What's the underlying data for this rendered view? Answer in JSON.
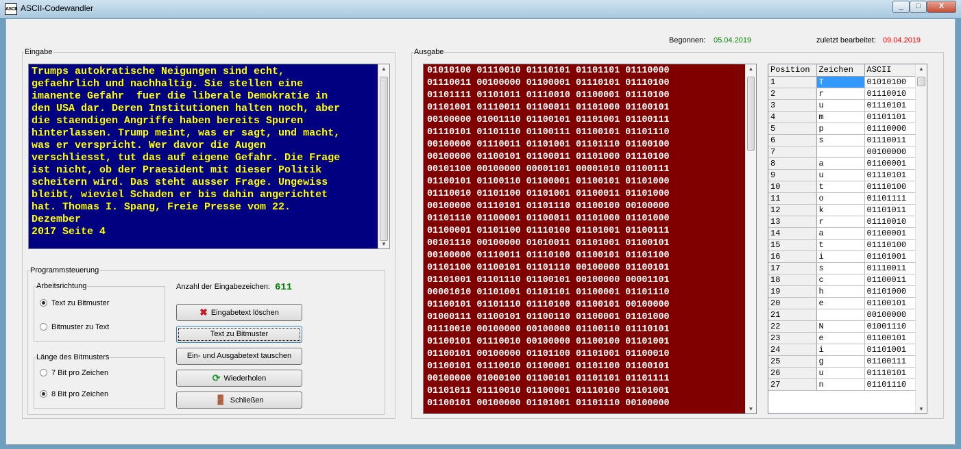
{
  "window": {
    "title": "ASCII-Codewandler",
    "icon_text": "ASCII",
    "minimize": "_",
    "maximize": "□",
    "close": "X"
  },
  "dates": {
    "started_label": "Begonnen:",
    "started_value": "05.04.2019",
    "edited_label": "zuletzt bearbeitet:",
    "edited_value": "09.04.2019"
  },
  "input": {
    "legend": "Eingabe",
    "text": "Trumps autokratische Neigungen sind echt,\ngefaehrlich und nachhaltig. Sie stellen eine\nimanente Gefahr  fuer die liberale Demokratie in\nden USA dar. Deren Institutionen halten noch, aber\ndie staendigen Angriffe haben bereits Spuren\nhinterlassen. Trump meint, was er sagt, und macht,\nwas er verspricht. Wer davor die Augen\nverschliesst, tut das auf eigene Gefahr. Die Frage\nist nicht, ob der Praesident mit dieser Politik\nscheitern wird. Das steht ausser Frage. Ungewiss\nbleibt, wieviel Schaden er bis dahin angerichtet\nhat. Thomas I. Spang, Freie Presse vom 22.\nDezember\n2017 Seite 4"
  },
  "control": {
    "legend": "Programmsteuerung",
    "direction": {
      "legend": "Arbeitsrichtung",
      "options": [
        "Text zu Bitmuster",
        "Bitmuster zu Text"
      ],
      "selected": 0
    },
    "length": {
      "legend": "Länge des Bitmusters",
      "options": [
        "7 Bit pro Zeichen",
        "8 Bit pro Zeichen"
      ],
      "selected": 1
    },
    "count_label": "Anzahl der Eingabezeichen:",
    "count_value": "611",
    "buttons": {
      "clear": "Eingabetext löschen",
      "convert": "Text zu Bitmuster",
      "swap": "Ein- und Ausgabetext tauschen",
      "repeat": "Wiederholen",
      "close": "Schließen"
    }
  },
  "output": {
    "legend": "Ausgabe",
    "text": "01010100 01110010 01110101 01101101 01110000\n01110011 00100000 01100001 01110101 01110100\n01101111 01101011 01110010 01100001 01110100\n01101001 01110011 01100011 01101000 01100101\n00100000 01001110 01100101 01101001 01100111\n01110101 01101110 01100111 01100101 01101110\n00100000 01110011 01101001 01101110 01100100\n00100000 01100101 01100011 01101000 01110100\n00101100 00100000 00001101 00001010 01100111\n01100101 01100110 01100001 01100101 01101000\n01110010 01101100 01101001 01100011 01101000\n00100000 01110101 01101110 01100100 00100000\n01101110 01100001 01100011 01101000 01101000\n01100001 01101100 01110100 01101001 01100111\n00101110 00100000 01010011 01101001 01100101\n00100000 01110011 01110100 01100101 01101100\n01101100 01100101 01101110 00100000 01100101\n01101001 01101110 01100101 00100000 00001101\n00001010 01101001 01101101 01100001 01101110\n01100101 01101110 01110100 01100101 00100000\n01000111 01100101 01100110 01100001 01101000\n01110010 00100000 00100000 01100110 01110101\n01100101 01110010 00100000 01100100 01101001\n01100101 00100000 01101100 01101001 01100010\n01100101 01110010 01100001 01101100 01100101\n00100000 01000100 01100101 01101101 01101111\n01101011 01110010 01100001 01110100 01101001\n01100101 00100000 01101001 01101110 00100000"
  },
  "table": {
    "headers": [
      "Position",
      "Zeichen",
      "ASCII"
    ],
    "rows": [
      [
        "1",
        "T",
        "01010100"
      ],
      [
        "2",
        "r",
        "01110010"
      ],
      [
        "3",
        "u",
        "01110101"
      ],
      [
        "4",
        "m",
        "01101101"
      ],
      [
        "5",
        "p",
        "01110000"
      ],
      [
        "6",
        "s",
        "01110011"
      ],
      [
        "7",
        "",
        "00100000"
      ],
      [
        "8",
        "a",
        "01100001"
      ],
      [
        "9",
        "u",
        "01110101"
      ],
      [
        "10",
        "t",
        "01110100"
      ],
      [
        "11",
        "o",
        "01101111"
      ],
      [
        "12",
        "k",
        "01101011"
      ],
      [
        "13",
        "r",
        "01110010"
      ],
      [
        "14",
        "a",
        "01100001"
      ],
      [
        "15",
        "t",
        "01110100"
      ],
      [
        "16",
        "i",
        "01101001"
      ],
      [
        "17",
        "s",
        "01110011"
      ],
      [
        "18",
        "c",
        "01100011"
      ],
      [
        "19",
        "h",
        "01101000"
      ],
      [
        "20",
        "e",
        "01100101"
      ],
      [
        "21",
        "",
        "00100000"
      ],
      [
        "22",
        "N",
        "01001110"
      ],
      [
        "23",
        "e",
        "01100101"
      ],
      [
        "24",
        "i",
        "01101001"
      ],
      [
        "25",
        "g",
        "01100111"
      ],
      [
        "26",
        "u",
        "01110101"
      ],
      [
        "27",
        "n",
        "01101110"
      ]
    ]
  },
  "colors": {
    "input_bg": "#000080",
    "input_fg": "#ffff00",
    "output_bg": "#800000",
    "output_fg": "#ffffff",
    "started": "#008000",
    "edited": "#ff0000",
    "count": "#008000",
    "selected_cell": "#3399ff"
  }
}
